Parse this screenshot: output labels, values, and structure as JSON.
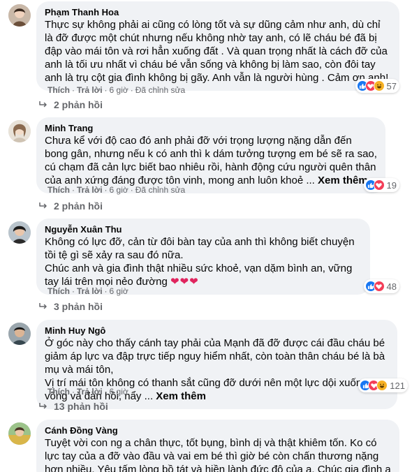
{
  "comments": [
    {
      "name": "Phạm Thanh Hoa",
      "text": "Thực sự không phải ai cũng có lòng tốt và sự dũng cảm như anh, dù chỉ là đỡ được một chút nhưng nếu không nhờ tay anh, có lẽ cháu bé đã bị đập vào mái tôn và rơi hẳn xuống đất . Và quan trọng nhất là cách đỡ của anh là tối ưu nhất vì cháu bé vẫn sống và không bị làm sao, còn đôi tay anh là trụ cột gia đình không bị gãy. Anh vẫn là người hùng . Cảm ơn anh!",
      "like": "Thích",
      "reply": "Trả lời",
      "time": "6 giờ",
      "edited": "Đã chỉnh sửa",
      "reaction_count": "57",
      "replies": "2 phản hồi"
    },
    {
      "name": "Minh Trang",
      "text": "Chưa kể với độ cao đó anh phải đỡ với trọng lượng nặng dẫn đến bong gân, nhưng nếu k có anh thì k dám tưởng tượng em bé sẽ ra sao, cú chạm đã cản lực biết bao nhiêu rồi, hành động cứu người quên thân của anh xứng đáng được tôn vinh, mong anh luôn khoẻ ...",
      "see_more": "Xem thêm",
      "like": "Thích",
      "reply": "Trả lời",
      "time": "6 giờ",
      "edited": "Đã chỉnh sửa",
      "reaction_count": "19",
      "replies": "2 phản hồi"
    },
    {
      "name": "Nguyễn Xuân Thu",
      "text1": "Không có lực đỡ, cản từ đôi bàn tay của anh thì không biết chuyện tồi tệ gì sẽ xảy ra sau đó nữa.",
      "text2": "Chúc anh và gia đình thật nhiều sức khoẻ, vạn dặm bình an, vững tay lái trên mọi nẻo đường",
      "emoji": "❤❤❤",
      "like": "Thích",
      "reply": "Trả lời",
      "time": "6 giờ",
      "reaction_count": "48",
      "replies": "3 phản hồi"
    },
    {
      "name": "Minh Huy Ngô",
      "text1": "Ở góc này cho thấy cánh tay phải của Mạnh đã đỡ được cái đầu cháu bé giảm áp lực va đập trực tiếp nguy hiểm nhất, còn toàn thân cháu bé là bà mụ và mái tôn,",
      "text2": "Vị trí mái tôn không có thanh sắt cũng đỡ dưới nên một lực dội xuống làm võng và đàn hồi, nẩy ...",
      "see_more": "Xem thêm",
      "like": "Thích",
      "reply": "Trả lời",
      "time": "6 giờ",
      "reaction_count": "121",
      "replies": "13 phản hồi"
    },
    {
      "name": "Cánh Đồng Vàng",
      "text": "Tuyệt vời con ng a chân thực, tốt bụng, bình dị và thật khiêm tốn. Ko có lực tay của a đỡ vào đầu và vai em bé thì giờ bé còn chấn thương nặng hơn nhiều. Yêu tấm lòng bồ tát và hiền lành đức độ của a. Chúc gia đình a mãi hạnh phúc và bình yên",
      "emoji": "🥰"
    }
  ],
  "colors": {
    "bubble": "#f0f2f5",
    "meta": "#65676b",
    "like": "#1877f2",
    "love": "#f33e58",
    "haha": "#f7b125"
  }
}
